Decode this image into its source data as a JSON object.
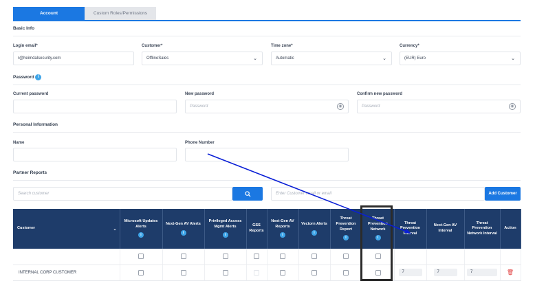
{
  "tabs": [
    {
      "label": "Account",
      "active": true
    },
    {
      "label": "Custom Roles/Permissions",
      "active": false
    }
  ],
  "basic_info": {
    "title": "Basic Info",
    "login_email": {
      "label": "Login email*",
      "value": "r@heimdalsecurity.com"
    },
    "customer": {
      "label": "Customer*",
      "value": "OfflineSales"
    },
    "time_zone": {
      "label": "Time zone*",
      "value": "Automatic"
    },
    "currency": {
      "label": "Currency*",
      "value": "(EUR) Euro"
    }
  },
  "password": {
    "title": "Password",
    "current": {
      "label": "Current password",
      "value": ""
    },
    "new": {
      "label": "New password",
      "placeholder": "Password"
    },
    "confirm": {
      "label": "Confirm new password",
      "placeholder": "Password"
    }
  },
  "personal": {
    "title": "Personal Information",
    "name": {
      "label": "Name",
      "value": ""
    },
    "phone": {
      "label": "Phone Number",
      "value": ""
    }
  },
  "partner_reports": {
    "title": "Partner Reports",
    "search_placeholder": "Search customer",
    "email_placeholder": "Enter Customer email or email",
    "add_button": "Add Customer"
  },
  "table": {
    "columns": [
      {
        "label": "Customer",
        "info": false
      },
      {
        "label": "Microsoft Updates Alerts",
        "info": true
      },
      {
        "label": "Next-Gen AV Alerts",
        "info": true
      },
      {
        "label": "Privileged Access Mgmt Alerts",
        "info": true
      },
      {
        "label": "GSS Reports",
        "info": false
      },
      {
        "label": "Next-Gen AV Reports",
        "info": true
      },
      {
        "label": "Vectorn Alerts",
        "info": true
      },
      {
        "label": "Threat Prevention Report",
        "info": true
      },
      {
        "label": "Threat Prevention Network",
        "info": true
      },
      {
        "label": "Threat Prevention Interval",
        "info": false
      },
      {
        "label": "Next-Gen AV Interval",
        "info": false
      },
      {
        "label": "Threat Prevention Network Interval",
        "info": false
      },
      {
        "label": "Action",
        "info": false
      }
    ],
    "rows": [
      {
        "name": "INTERNAL CORP CUSTOMER",
        "interval_1": "7",
        "interval_2": "7",
        "interval_3": "7"
      }
    ]
  },
  "colors": {
    "accent": "#1b78e2",
    "header": "#1e3c6a",
    "info": "#3fa5e8",
    "annotation": "#0a1fd6",
    "delete": "#e03b3b"
  },
  "icons": {
    "search": "search-icon",
    "chevron": "chevron-down-icon",
    "eye": "eye-icon",
    "delete": "trash-icon",
    "info": "info-icon"
  }
}
